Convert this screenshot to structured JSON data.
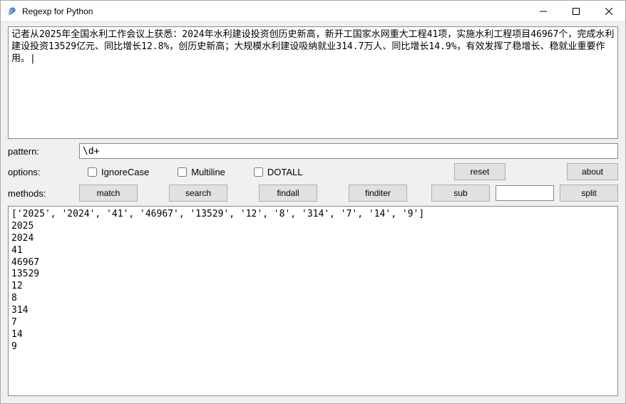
{
  "window": {
    "title": "Regexp for Python"
  },
  "input_text": "记者从2025年全国水利工作会议上获悉：2024年水利建设投资创历史新高，新开工国家水网重大工程41项，实施水利工程项目46967个，完成水利建设投资13529亿元、同比增长12.8%，创历史新高；大规模水利建设吸纳就业314.7万人、同比增长14.9%，有效发挥了稳增长、稳就业重要作用。|",
  "labels": {
    "pattern": "pattern:",
    "options": "options:",
    "methods": "methods:"
  },
  "pattern_value": "\\d+",
  "options": {
    "ignorecase": "IgnoreCase",
    "multiline": "Multiline",
    "dotall": "DOTALL"
  },
  "buttons": {
    "reset": "reset",
    "about": "about",
    "match": "match",
    "search": "search",
    "findall": "findall",
    "finditer": "finditer",
    "sub": "sub",
    "split": "split"
  },
  "sub_value": "",
  "output_text": "['2025', '2024', '41', '46967', '13529', '12', '8', '314', '7', '14', '9']\n2025\n2024\n41\n46967\n13529\n12\n8\n314\n7\n14\n9"
}
